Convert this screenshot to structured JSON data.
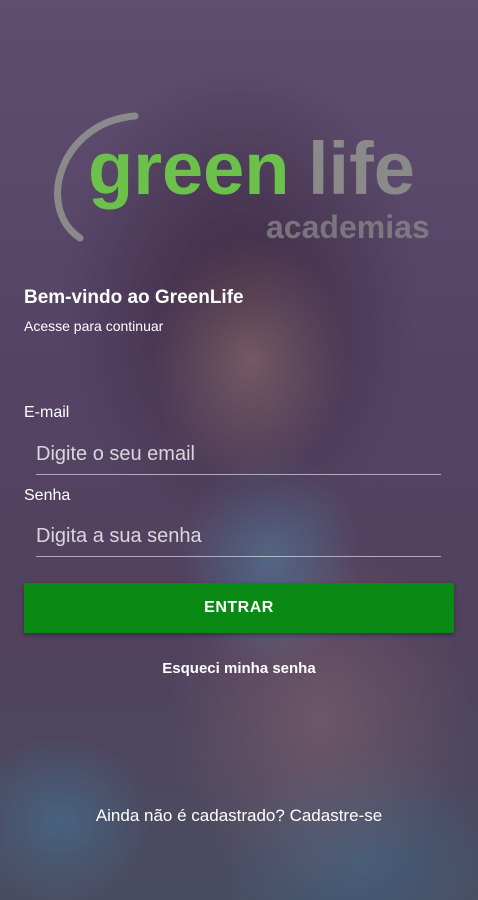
{
  "logo": {
    "word_green": "green",
    "word_life": "life",
    "sub": "academias",
    "colors": {
      "green": "#6cc14a",
      "gray": "#8a8a8a"
    }
  },
  "welcome": {
    "title": "Bem-vindo ao GreenLife",
    "subtitle": "Acesse para continuar"
  },
  "form": {
    "email_label": "E-mail",
    "email_placeholder": "Digite o seu email",
    "email_value": "",
    "password_label": "Senha",
    "password_placeholder": "Digita a sua senha",
    "password_value": "",
    "submit_label": "ENTRAR",
    "forgot_label": "Esqueci minha senha"
  },
  "footer": {
    "signup_label": "Ainda não é cadastrado? Cadastre-se"
  },
  "colors": {
    "button": "#0a8a14",
    "text": "#ffffff"
  }
}
